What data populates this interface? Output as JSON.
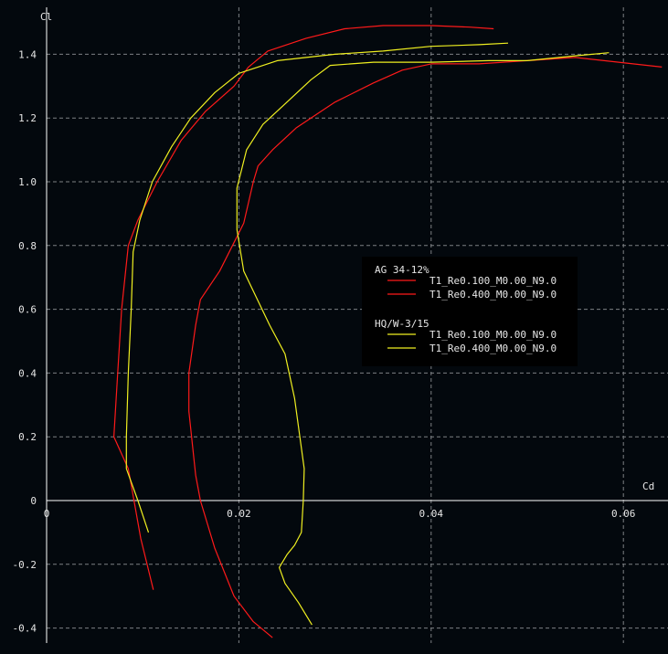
{
  "chart_data": {
    "type": "line",
    "xlabel": "Cd",
    "ylabel": "Cl",
    "xlim": [
      0,
      0.064
    ],
    "ylim": [
      -0.44,
      1.52
    ],
    "grid": true,
    "legend_position": "center-right",
    "x_ticks": [
      {
        "value": 0,
        "label": "0"
      },
      {
        "value": 0.02,
        "label": "0.02"
      },
      {
        "value": 0.04,
        "label": "0.04"
      },
      {
        "value": 0.06,
        "label": "0.06"
      }
    ],
    "y_ticks": [
      {
        "value": -0.4,
        "label": "-0.4"
      },
      {
        "value": -0.2,
        "label": "-0.2"
      },
      {
        "value": 0,
        "label": "0"
      },
      {
        "value": 0.2,
        "label": "0.2"
      },
      {
        "value": 0.4,
        "label": "0.4"
      },
      {
        "value": 0.6,
        "label": "0.6"
      },
      {
        "value": 0.8,
        "label": "0.8"
      },
      {
        "value": 1.0,
        "label": "1.0"
      },
      {
        "value": 1.2,
        "label": "1.2"
      },
      {
        "value": 1.4,
        "label": "1.4"
      }
    ],
    "groups": [
      {
        "title": "AG 34-12%",
        "color": "#ff1a1a",
        "series": [
          {
            "name": "T1_Re0.100_M0.00_N9.0",
            "points": [
              [
                0.0111,
                -0.28
              ],
              [
                0.0098,
                -0.12
              ],
              [
                0.0085,
                0.1
              ],
              [
                0.007,
                0.2
              ],
              [
                0.0074,
                0.4
              ],
              [
                0.0078,
                0.6
              ],
              [
                0.0085,
                0.8
              ],
              [
                0.0095,
                0.88
              ],
              [
                0.0115,
                1.0
              ],
              [
                0.014,
                1.13
              ],
              [
                0.0165,
                1.22
              ],
              [
                0.0195,
                1.3
              ],
              [
                0.021,
                1.36
              ],
              [
                0.023,
                1.41
              ],
              [
                0.027,
                1.45
              ],
              [
                0.031,
                1.48
              ],
              [
                0.035,
                1.49
              ],
              [
                0.04,
                1.49
              ],
              [
                0.044,
                1.485
              ],
              [
                0.0465,
                1.48
              ]
            ]
          },
          {
            "name": "T1_Re0.400_M0.00_N9.0",
            "points": [
              [
                0.0235,
                -0.43
              ],
              [
                0.0215,
                -0.38
              ],
              [
                0.0195,
                -0.3
              ],
              [
                0.0175,
                -0.15
              ],
              [
                0.016,
                0
              ],
              [
                0.0155,
                0.08
              ],
              [
                0.0148,
                0.28
              ],
              [
                0.0148,
                0.4
              ],
              [
                0.0155,
                0.55
              ],
              [
                0.016,
                0.63
              ],
              [
                0.018,
                0.72
              ],
              [
                0.019,
                0.78
              ],
              [
                0.0205,
                0.87
              ],
              [
                0.0215,
                1.0
              ],
              [
                0.022,
                1.05
              ],
              [
                0.0235,
                1.1
              ],
              [
                0.026,
                1.17
              ],
              [
                0.03,
                1.25
              ],
              [
                0.034,
                1.31
              ],
              [
                0.037,
                1.35
              ],
              [
                0.04,
                1.37
              ],
              [
                0.045,
                1.37
              ],
              [
                0.05,
                1.38
              ],
              [
                0.055,
                1.39
              ],
              [
                0.0595,
                1.375
              ],
              [
                0.064,
                1.36
              ]
            ]
          }
        ]
      },
      {
        "title": "HQ/W-3/15",
        "color": "#f0f020",
        "series": [
          {
            "name": "T1_Re0.100_M0.00_N9.0",
            "points": [
              [
                0.0106,
                -0.1
              ],
              [
                0.0095,
                0
              ],
              [
                0.0083,
                0.1
              ],
              [
                0.0083,
                0.2
              ],
              [
                0.0085,
                0.4
              ],
              [
                0.0088,
                0.6
              ],
              [
                0.009,
                0.78
              ],
              [
                0.0097,
                0.88
              ],
              [
                0.011,
                1.0
              ],
              [
                0.013,
                1.11
              ],
              [
                0.015,
                1.2
              ],
              [
                0.0175,
                1.28
              ],
              [
                0.02,
                1.34
              ],
              [
                0.024,
                1.38
              ],
              [
                0.03,
                1.4
              ],
              [
                0.035,
                1.41
              ],
              [
                0.04,
                1.425
              ],
              [
                0.045,
                1.43
              ],
              [
                0.048,
                1.435
              ]
            ]
          },
          {
            "name": "T1_Re0.400_M0.00_N9.0",
            "points": [
              [
                0.0276,
                -0.39
              ],
              [
                0.0262,
                -0.32
              ],
              [
                0.0248,
                -0.26
              ],
              [
                0.0242,
                -0.21
              ],
              [
                0.025,
                -0.17
              ],
              [
                0.0258,
                -0.14
              ],
              [
                0.0265,
                -0.1
              ],
              [
                0.0267,
                0
              ],
              [
                0.0268,
                0.1
              ],
              [
                0.0258,
                0.32
              ],
              [
                0.0248,
                0.46
              ],
              [
                0.0232,
                0.55
              ],
              [
                0.0205,
                0.72
              ],
              [
                0.0198,
                0.85
              ],
              [
                0.0198,
                0.98
              ],
              [
                0.0208,
                1.1
              ],
              [
                0.0225,
                1.18
              ],
              [
                0.025,
                1.25
              ],
              [
                0.0275,
                1.32
              ],
              [
                0.0295,
                1.365
              ],
              [
                0.034,
                1.375
              ],
              [
                0.04,
                1.375
              ],
              [
                0.046,
                1.38
              ],
              [
                0.05,
                1.38
              ],
              [
                0.055,
                1.395
              ],
              [
                0.0585,
                1.405
              ]
            ]
          }
        ]
      }
    ]
  }
}
